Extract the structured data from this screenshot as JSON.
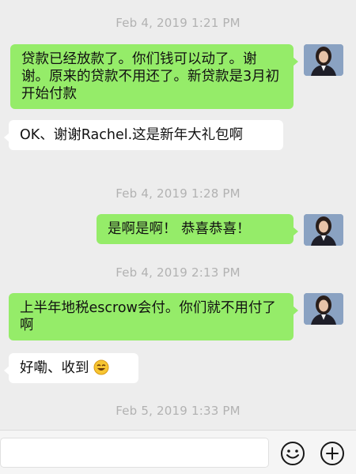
{
  "messages": [
    {
      "type": "time",
      "text": "Feb 4, 2019 1:21 PM"
    },
    {
      "type": "sent",
      "text": "贷款已经放款了。你们钱可以动了。谢谢。原来的贷款不用还了。新贷款是3月初开始付款"
    },
    {
      "type": "received",
      "text": "OK、谢谢Rachel.这是新年大礼包啊"
    },
    {
      "type": "time",
      "text": "Feb 4, 2019 1:28 PM"
    },
    {
      "type": "sent",
      "text": "是啊是啊！ 恭喜恭喜！"
    },
    {
      "type": "time",
      "text": "Feb 4, 2019 2:13 PM"
    },
    {
      "type": "sent",
      "text": "上半年地税escrow会付。你们就不用付了啊"
    },
    {
      "type": "received",
      "text": "好嘞、收到",
      "emoji": "grinning-face-emoji"
    },
    {
      "type": "time",
      "text": "Feb 5, 2019 1:33 PM"
    }
  ],
  "input_bar": {
    "value": "",
    "emoji_button_icon": "smiley-face-icon",
    "more_button_icon": "plus-circle-icon"
  },
  "colors": {
    "background": "#ededed",
    "sent_bubble": "#95ec69",
    "received_bubble": "#ffffff",
    "timestamp": "#b2b2b2"
  }
}
